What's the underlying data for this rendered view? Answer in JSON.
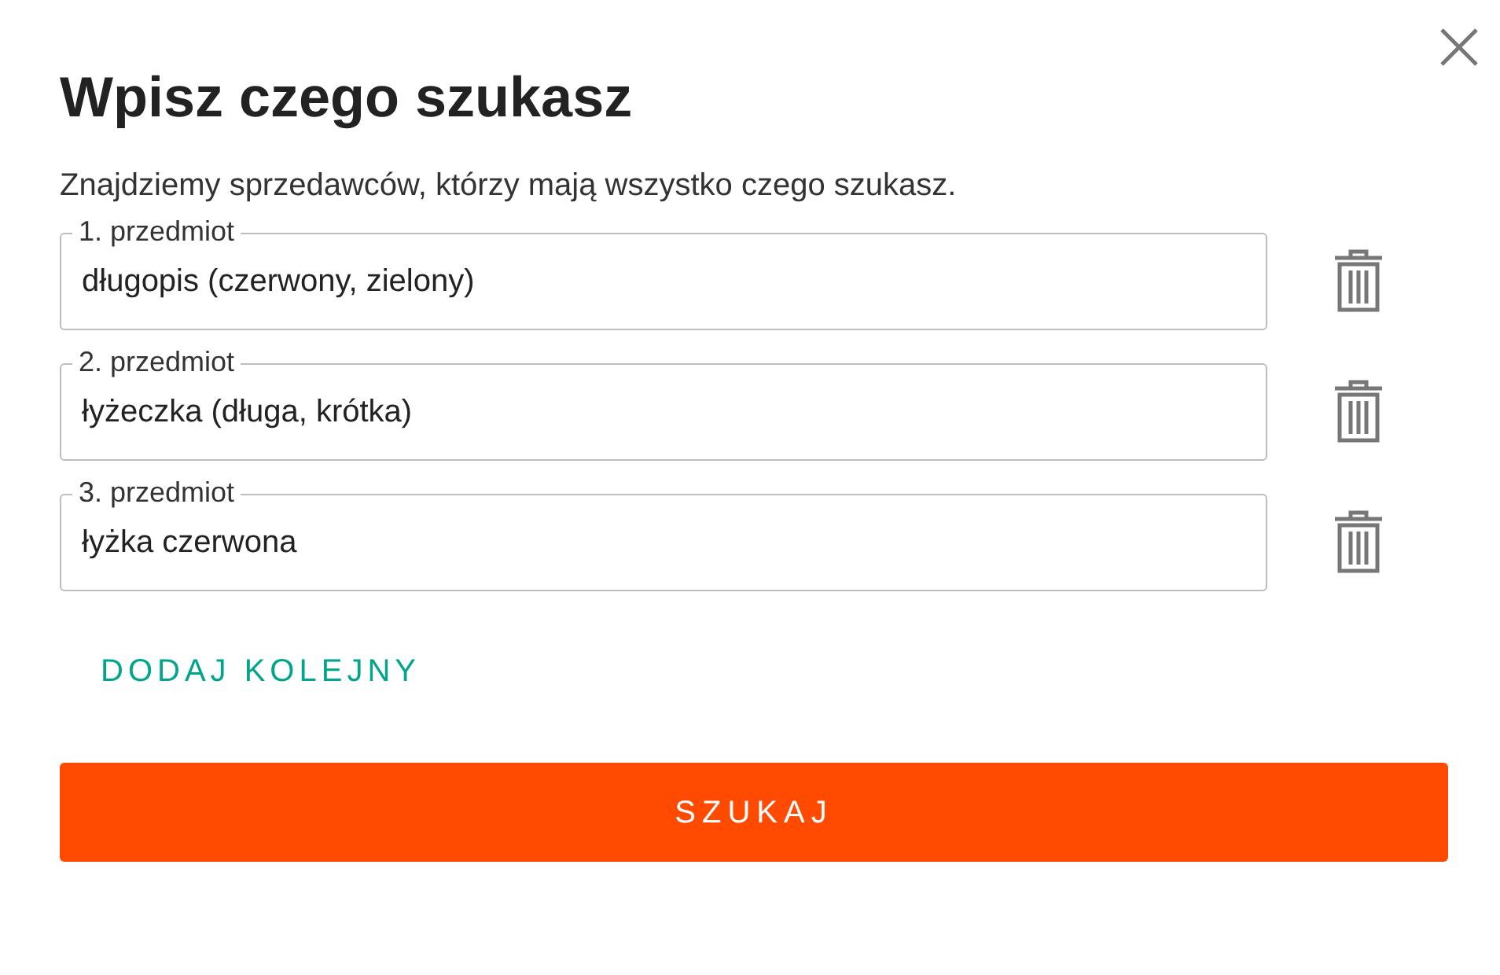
{
  "dialog": {
    "title": "Wpisz czego szukasz",
    "description": "Znajdziemy sprzedawców, którzy mają wszystko czego szukasz."
  },
  "items": [
    {
      "label": "1. przedmiot",
      "value": "długopis (czerwony, zielony)"
    },
    {
      "label": "2. przedmiot",
      "value": "łyżeczka (długa, krótka)"
    },
    {
      "label": "3. przedmiot",
      "value": "łyżka czerwona"
    }
  ],
  "add_link": "DODAJ KOLEJNY",
  "search_button": "SZUKAJ"
}
